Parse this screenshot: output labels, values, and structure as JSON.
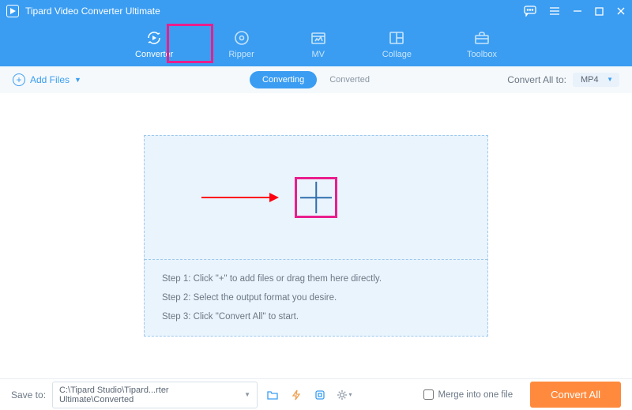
{
  "titlebar": {
    "title": "Tipard Video Converter Ultimate"
  },
  "nav": {
    "items": [
      {
        "label": "Converter"
      },
      {
        "label": "Ripper"
      },
      {
        "label": "MV"
      },
      {
        "label": "Collage"
      },
      {
        "label": "Toolbox"
      }
    ]
  },
  "toolbar": {
    "add_files": "Add Files",
    "seg_converting": "Converting",
    "seg_converted": "Converted",
    "convert_all_label": "Convert All to:",
    "format_selected": "MP4"
  },
  "dropzone": {
    "step1": "Step 1: Click \"+\" to add files or drag them here directly.",
    "step2": "Step 2: Select the output format you desire.",
    "step3": "Step 3: Click \"Convert All\" to start."
  },
  "bottom": {
    "save_to_label": "Save to:",
    "path": "C:\\Tipard Studio\\Tipard...rter Ultimate\\Converted",
    "merge_label": "Merge into one file",
    "convert_all_btn": "Convert All"
  }
}
